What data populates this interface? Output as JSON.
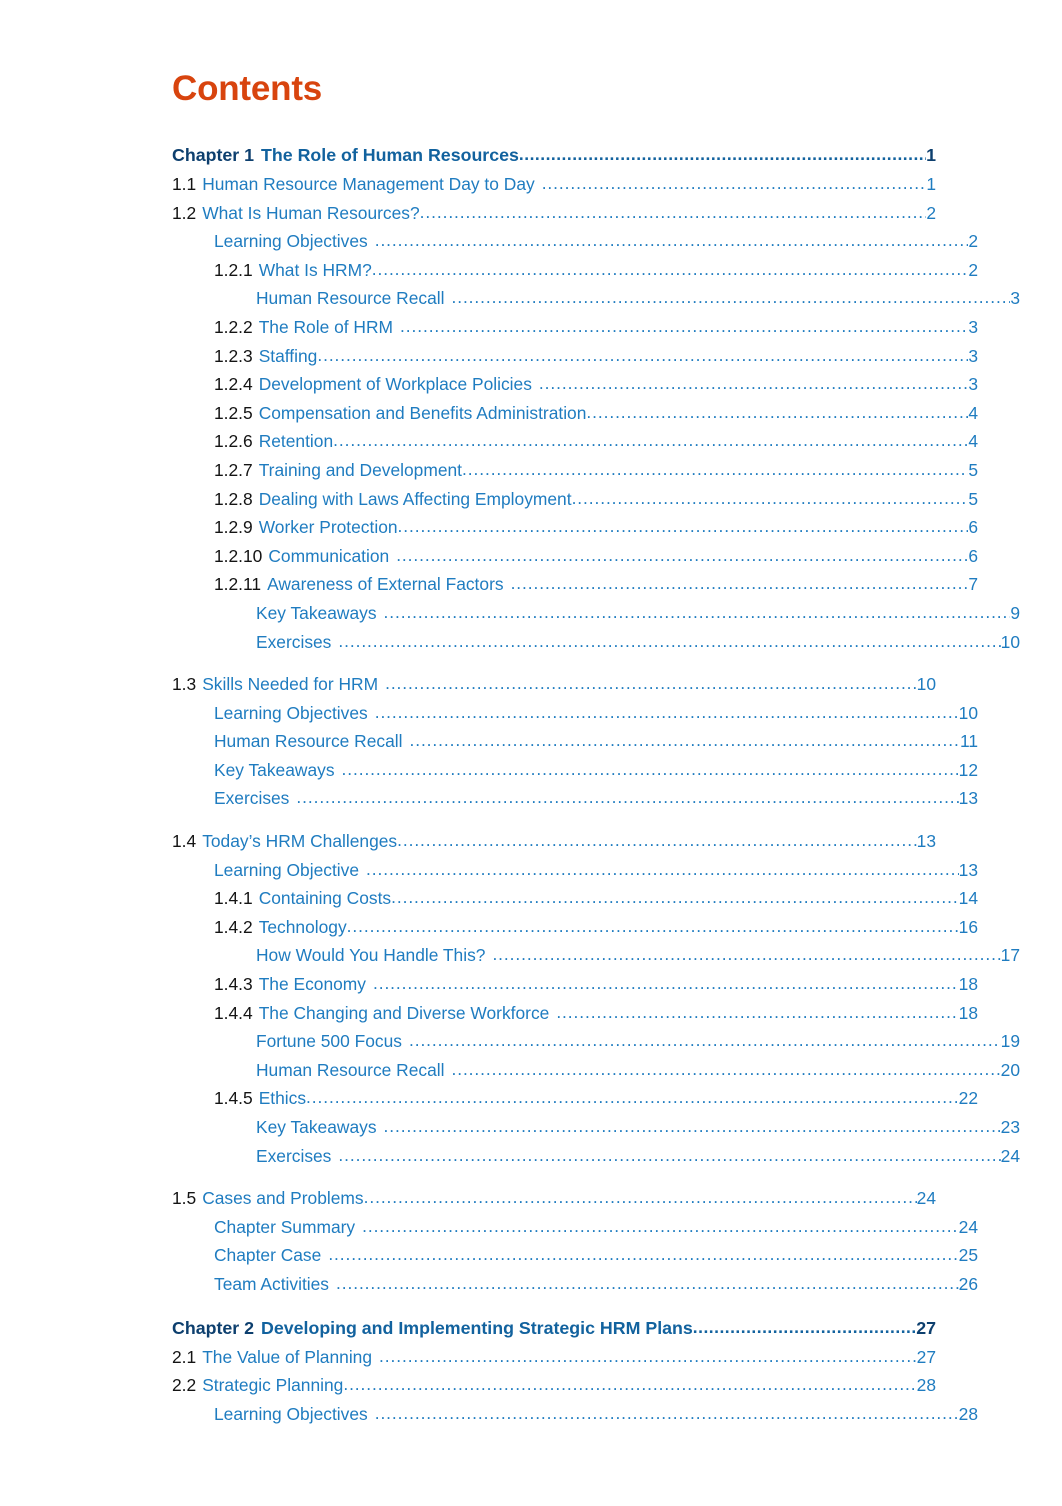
{
  "page": {
    "title": "Contents",
    "title_color": "#d8440e",
    "entry_color": "#1f7cc0",
    "chapter_color": "#0d3f6e",
    "number_color": "#141414"
  },
  "entries": [
    {
      "num": "Chapter 1",
      "label": "The Role of Human Resources",
      "page": "1",
      "level": 1,
      "type": "chapter",
      "gap": false
    },
    {
      "num": "1.1",
      "label": "Human Resource Management Day to Day",
      "page": "1",
      "level": 1,
      "type": "section",
      "gap": true
    },
    {
      "num": "1.2",
      "label": "What Is Human Resources?",
      "page": "2",
      "level": 1,
      "type": "section",
      "gap": false
    },
    {
      "num": "",
      "label": "Learning Objectives",
      "page": "2",
      "level": 2,
      "type": "plain",
      "gap": true
    },
    {
      "num": "1.2.1",
      "label": "What Is HRM?",
      "page": "2",
      "level": 2,
      "type": "section",
      "gap": false
    },
    {
      "num": "",
      "label": "Human Resource Recall",
      "page": "3",
      "level": 3,
      "type": "plain",
      "gap": true
    },
    {
      "num": "1.2.2",
      "label": "The Role of HRM",
      "page": "3",
      "level": 2,
      "type": "section",
      "gap": true
    },
    {
      "num": "1.2.3",
      "label": "Staffing",
      "page": "3",
      "level": 2,
      "type": "section",
      "gap": false
    },
    {
      "num": "1.2.4",
      "label": "Development of Workplace Policies",
      "page": "3",
      "level": 2,
      "type": "section",
      "gap": true
    },
    {
      "num": "1.2.5",
      "label": "Compensation and Benefits Administration",
      "page": "4",
      "level": 2,
      "type": "section",
      "gap": false
    },
    {
      "num": "1.2.6",
      "label": "Retention",
      "page": "4",
      "level": 2,
      "type": "section",
      "gap": false
    },
    {
      "num": "1.2.7",
      "label": "Training and Development",
      "page": "5",
      "level": 2,
      "type": "section",
      "gap": false
    },
    {
      "num": "1.2.8",
      "label": "Dealing with Laws Affecting Employment",
      "page": "5",
      "level": 2,
      "type": "section",
      "gap": false
    },
    {
      "num": "1.2.9",
      "label": "Worker Protection",
      "page": "6",
      "level": 2,
      "type": "section",
      "gap": false
    },
    {
      "num": "1.2.10",
      "label": "Communication",
      "page": "6",
      "level": 2,
      "type": "section",
      "gap": true
    },
    {
      "num": "1.2.11",
      "label": "Awareness of External Factors",
      "page": "7",
      "level": 2,
      "type": "section",
      "gap": true
    },
    {
      "num": "",
      "label": "Key Takeaways",
      "page": "9",
      "level": 3,
      "type": "plain",
      "gap": true
    },
    {
      "num": "",
      "label": "Exercises",
      "page": "10",
      "level": 3,
      "type": "plain",
      "gap": true
    },
    {
      "num": "1.3",
      "label": "Skills Needed for HRM",
      "page": "10",
      "level": 1,
      "type": "section",
      "gap": true
    },
    {
      "num": "",
      "label": "Learning Objectives",
      "page": "10",
      "level": 2,
      "type": "plain",
      "gap": true
    },
    {
      "num": "",
      "label": "Human Resource Recall",
      "page": "11",
      "level": 2,
      "type": "plain",
      "gap": true
    },
    {
      "num": "",
      "label": "Key Takeaways",
      "page": "12",
      "level": 2,
      "type": "plain",
      "gap": true
    },
    {
      "num": "",
      "label": "Exercises",
      "page": "13",
      "level": 2,
      "type": "plain",
      "gap": true
    },
    {
      "num": "1.4",
      "label": "Today’s HRM Challenges",
      "page": "13",
      "level": 1,
      "type": "section",
      "gap": false
    },
    {
      "num": "",
      "label": "Learning Objective",
      "page": "13",
      "level": 2,
      "type": "plain",
      "gap": true
    },
    {
      "num": "1.4.1",
      "label": "Containing Costs",
      "page": "14",
      "level": 2,
      "type": "section",
      "gap": false
    },
    {
      "num": "1.4.2",
      "label": "Technology",
      "page": "16",
      "level": 2,
      "type": "section",
      "gap": false
    },
    {
      "num": "",
      "label": "How Would You Handle This?",
      "page": "17",
      "level": 3,
      "type": "plain",
      "gap": true
    },
    {
      "num": "1.4.3",
      "label": "The Economy",
      "page": "18",
      "level": 2,
      "type": "section",
      "gap": true
    },
    {
      "num": "1.4.4",
      "label": "The Changing and Diverse Workforce",
      "page": "18",
      "level": 2,
      "type": "section",
      "gap": true
    },
    {
      "num": "",
      "label": "Fortune 500 Focus",
      "page": "19",
      "level": 3,
      "type": "plain",
      "gap": true
    },
    {
      "num": "",
      "label": "Human Resource Recall",
      "page": "20",
      "level": 3,
      "type": "plain",
      "gap": true
    },
    {
      "num": "1.4.5",
      "label": "Ethics",
      "page": "22",
      "level": 2,
      "type": "section",
      "gap": false
    },
    {
      "num": "",
      "label": "Key Takeaways",
      "page": "23",
      "level": 3,
      "type": "plain",
      "gap": true
    },
    {
      "num": "",
      "label": "Exercises",
      "page": "24",
      "level": 3,
      "type": "plain",
      "gap": true
    },
    {
      "num": "1.5",
      "label": "Cases and Problems",
      "page": "24",
      "level": 1,
      "type": "section",
      "gap": false
    },
    {
      "num": "",
      "label": "Chapter Summary",
      "page": "24",
      "level": 2,
      "type": "plain",
      "gap": true
    },
    {
      "num": "",
      "label": "Chapter Case",
      "page": "25",
      "level": 2,
      "type": "plain",
      "gap": true
    },
    {
      "num": "",
      "label": "Team Activities",
      "page": "26",
      "level": 2,
      "type": "plain",
      "gap": true
    },
    {
      "num": "Chapter 2",
      "label": "Developing and Implementing Strategic HRM Plans",
      "page": "27",
      "level": 1,
      "type": "chapter",
      "gap": false
    },
    {
      "num": "2.1",
      "label": "The Value of Planning",
      "page": "27",
      "level": 1,
      "type": "section",
      "gap": true
    },
    {
      "num": "2.2",
      "label": "Strategic Planning",
      "page": "28",
      "level": 1,
      "type": "section",
      "gap": false
    },
    {
      "num": "",
      "label": "Learning Objectives",
      "page": "28",
      "level": 2,
      "type": "plain",
      "gap": true
    }
  ]
}
